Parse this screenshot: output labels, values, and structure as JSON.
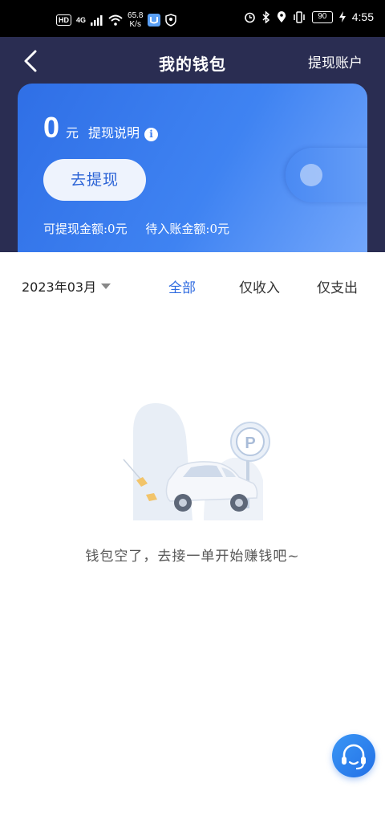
{
  "status_bar": {
    "hd": "HD",
    "network": "4G",
    "speed_value": "65.8",
    "speed_unit": "K/s",
    "battery": "90",
    "time": "4:55"
  },
  "header": {
    "title": "我的钱包",
    "back_icon": "chevron-left-icon",
    "account_link": "提现账户"
  },
  "wallet": {
    "balance": "0",
    "unit": "元",
    "help_label": "提现说明",
    "info_icon": "i",
    "withdraw_button": "去提现",
    "withdrawable": "可提现金额:0元",
    "pending": "待入账金额:0元"
  },
  "filter": {
    "month": "2023年03月",
    "tabs": [
      {
        "label": "全部",
        "active": true
      },
      {
        "label": "仅收入",
        "active": false
      },
      {
        "label": "仅支出",
        "active": false
      }
    ]
  },
  "empty_state": {
    "message": "钱包空了，去接一单开始赚钱吧~",
    "parking_sign": "P"
  },
  "service": {
    "icon": "headset-icon"
  },
  "colors": {
    "header_bg": "#2a2d52",
    "card_accent": "#3f83f2",
    "active_tab": "#2f6be0"
  }
}
